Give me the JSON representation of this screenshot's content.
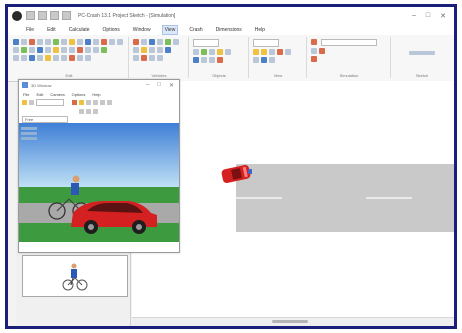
{
  "app": {
    "title": "PC-Crash 13.1 Project Sketch - [Simulation]"
  },
  "menu": {
    "items": [
      "File",
      "Edit",
      "Calculate",
      "Options",
      "Window",
      "View",
      "Crash",
      "Dimensions",
      "Help"
    ],
    "active_index": 5
  },
  "ribbon": {
    "groups": [
      "Edit",
      "Vehicles",
      "Objects",
      "View",
      "Simulation",
      "Sketch"
    ]
  },
  "sub_window": {
    "title": "3D Window",
    "menu": [
      "File",
      "Edit",
      "Camera",
      "Options",
      "Help"
    ],
    "view_select": "Vehicle 1",
    "camera_select": "Free"
  },
  "colors": {
    "frame_border": "#1a1f7a",
    "car_red": "#d42020",
    "road_gray": "#c9c9c9",
    "grass": "#3e9a3e",
    "sky_top": "#3f7fd6"
  }
}
